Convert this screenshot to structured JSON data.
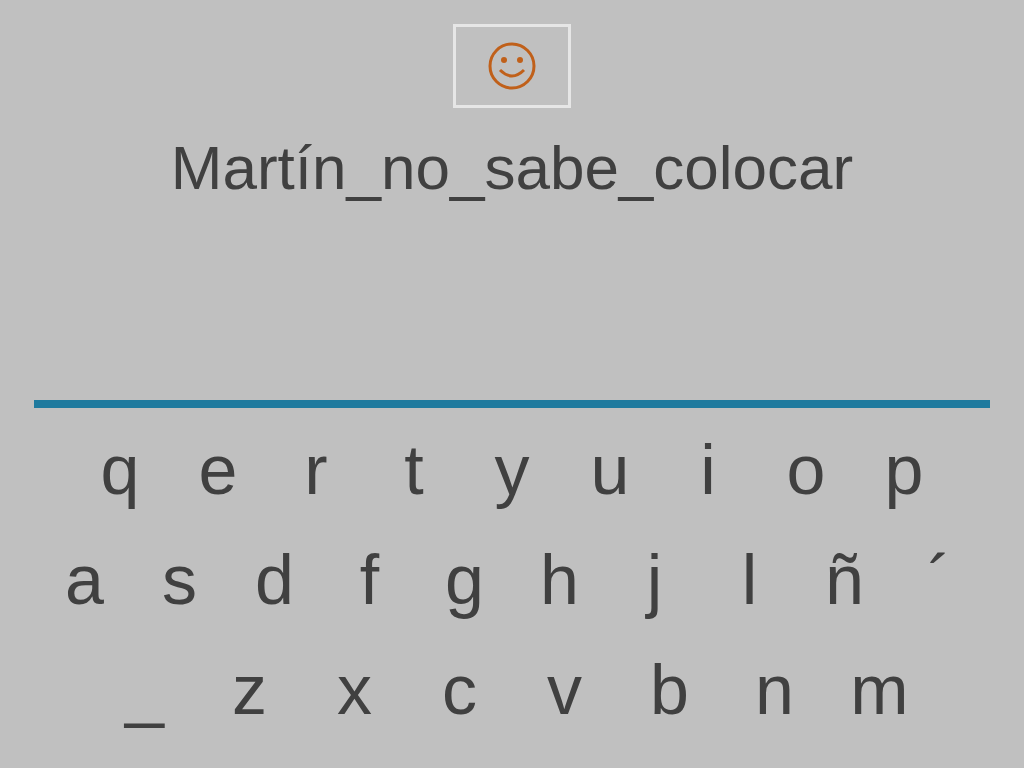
{
  "title": "Martín_no_sabe_colocar",
  "keyboard": [
    [
      "q",
      "e",
      "r",
      "t",
      "y",
      "u",
      "i",
      "o",
      "p"
    ],
    [
      "a",
      "s",
      "d",
      "f",
      "g",
      "h",
      "j",
      "l",
      "ñ",
      "´"
    ],
    [
      "_",
      "z",
      "x",
      "c",
      "v",
      "b",
      "n",
      "m"
    ]
  ]
}
